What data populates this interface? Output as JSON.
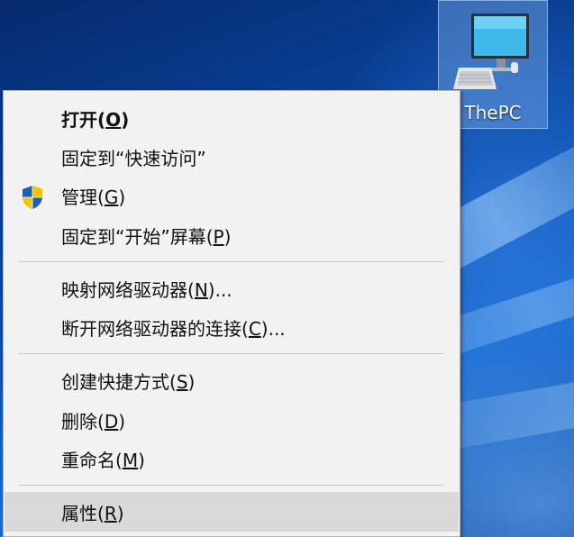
{
  "desktop": {
    "icon": {
      "label": "ThePC",
      "icon_name": "computer-icon"
    }
  },
  "menu": {
    "items": [
      {
        "pre": "打开(",
        "key": "O",
        "post": ")",
        "bold": true
      },
      {
        "pre": "固定到“快速访问”",
        "key": "",
        "post": ""
      },
      {
        "pre": "管理(",
        "key": "G",
        "post": ")",
        "icon": "uac-shield-icon"
      },
      {
        "pre": "固定到“开始”屏幕(",
        "key": "P",
        "post": ")"
      },
      {
        "pre": "映射网络驱动器(",
        "key": "N",
        "post": ")..."
      },
      {
        "pre": "断开网络驱动器的连接(",
        "key": "C",
        "post": ")..."
      },
      {
        "pre": "创建快捷方式(",
        "key": "S",
        "post": ")"
      },
      {
        "pre": "删除(",
        "key": "D",
        "post": ")"
      },
      {
        "pre": "重命名(",
        "key": "M",
        "post": ")"
      },
      {
        "pre": "属性(",
        "key": "R",
        "post": ")",
        "highlighted": true
      }
    ]
  },
  "colors": {
    "menu_bg": "#f2f2f2",
    "highlight_bg": "#d9d9d9",
    "separator": "#c8c8c8",
    "shield_blue": "#1b5fb8",
    "shield_yellow": "#f5c400"
  }
}
